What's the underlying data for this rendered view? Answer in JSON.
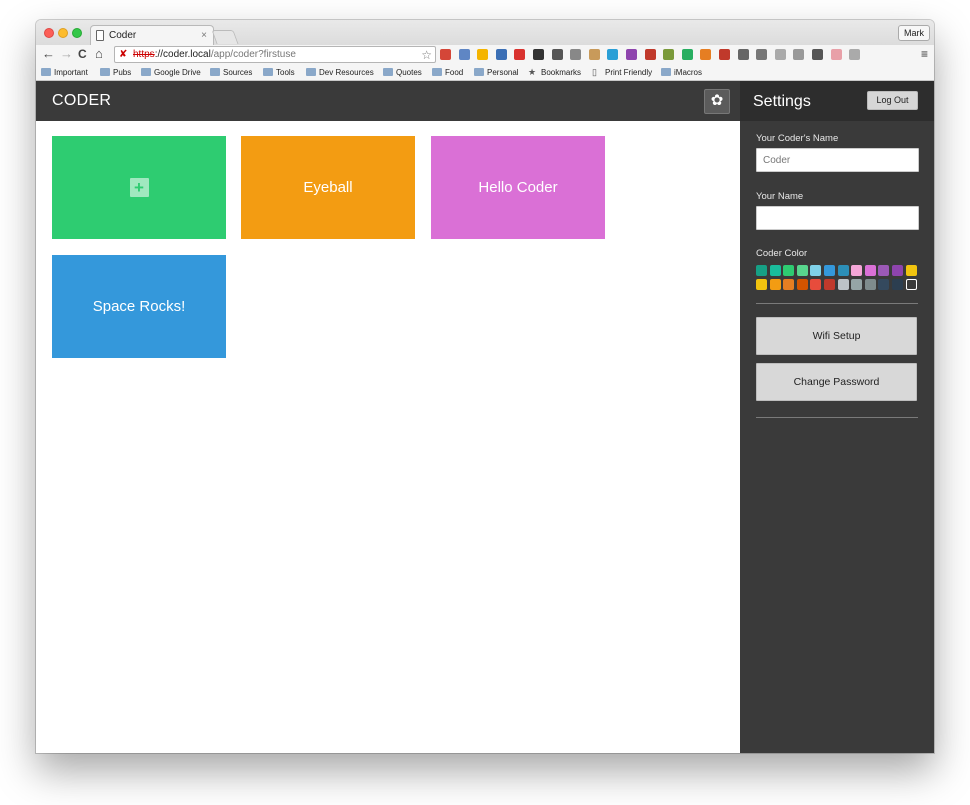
{
  "browser": {
    "tab_title": "Coder",
    "tab_close": "×",
    "profile": "Mark",
    "nav": {
      "back": "←",
      "forward": "→",
      "reload": "C",
      "home": "⌂"
    },
    "url": {
      "scheme": "https",
      "sep": "://",
      "host": "coder.local",
      "path": "/app/coder?firstuse"
    },
    "menu": "≡",
    "extension_colors": [
      "#d44638",
      "#5f86c4",
      "#f4b400",
      "#3b6fb5",
      "#d9332f",
      "#333333",
      "#555555",
      "#888888",
      "#c89a5a",
      "#2a9fd6",
      "#8e44ad",
      "#c0392b",
      "#7a9a3a",
      "#27ae60",
      "#e67e22",
      "#c0392b",
      "#666666",
      "#777777",
      "#aaaaaa",
      "#999999",
      "#555555",
      "#e8a0a8",
      "#aaaaaa"
    ],
    "bookmarks": [
      {
        "label": "Important",
        "icon": "folder-icon"
      },
      {
        "label": "Pubs",
        "icon": "folder-icon"
      },
      {
        "label": "Google Drive",
        "icon": "folder-icon"
      },
      {
        "label": "Sources",
        "icon": "folder-icon"
      },
      {
        "label": "Tools",
        "icon": "folder-icon"
      },
      {
        "label": "Dev Resources",
        "icon": "folder-icon"
      },
      {
        "label": "Quotes",
        "icon": "folder-icon"
      },
      {
        "label": "Food",
        "icon": "folder-icon"
      },
      {
        "label": "Personal",
        "icon": "folder-icon"
      },
      {
        "label": "Bookmarks",
        "icon": "star-icon",
        "glyph": "★"
      },
      {
        "label": "Print Friendly",
        "icon": "page-icon",
        "glyph": "▯"
      },
      {
        "label": "iMacros",
        "icon": "folder-icon"
      }
    ]
  },
  "app": {
    "brand": "CODER",
    "gear_glyph": "✿",
    "tiles": [
      {
        "name": "new-app-tile",
        "label": "",
        "color": "#2ecc71",
        "add": true
      },
      {
        "name": "app-tile-eyeball",
        "label": "Eyeball",
        "color": "#f39c12"
      },
      {
        "name": "app-tile-hello-coder",
        "label": "Hello Coder",
        "color": "#da70d6"
      },
      {
        "name": "app-tile-space-rocks",
        "label": "Space Rocks!",
        "color": "#3498db"
      }
    ],
    "plus_glyph": "+"
  },
  "settings": {
    "title": "Settings",
    "logout_label": "Log Out",
    "coder_name_label": "Your Coder's Name",
    "coder_name_value": "Coder",
    "your_name_label": "Your Name",
    "your_name_value": "",
    "color_label": "Coder Color",
    "colors_row1": [
      "#16a085",
      "#1abc9c",
      "#2ecc71",
      "#58d68d",
      "#7fd1e8",
      "#3498db",
      "#2c8fb8",
      "#f4a6d7",
      "#da70d6",
      "#9b59b6",
      "#8e44ad",
      "#f1c40f"
    ],
    "colors_row2": [
      "#f1c40f",
      "#f39c12",
      "#e67e22",
      "#d35400",
      "#e74c3c",
      "#c0392b",
      "#bdc3c7",
      "#95a5a6",
      "#7f8c8d",
      "#34495e",
      "#2c3e50",
      "#3a3a3a"
    ],
    "selected_color_index_row2": 11,
    "wifi_label": "Wifi Setup",
    "password_label": "Change Password"
  }
}
